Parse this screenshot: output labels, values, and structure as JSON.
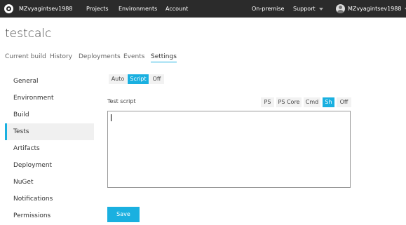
{
  "topbar": {
    "username": "MZvyagintsev1988",
    "nav": [
      "Projects",
      "Environments",
      "Account"
    ],
    "right": {
      "on_premise": "On-premise",
      "support": "Support",
      "user": "MZvyagintsev1988"
    }
  },
  "project": {
    "title": "testcalc"
  },
  "tabs": [
    "Current build",
    "History",
    "Deployments",
    "Events",
    "Settings"
  ],
  "active_tab": "Settings",
  "sidebar": {
    "items": [
      "General",
      "Environment",
      "Build",
      "Tests",
      "Artifacts",
      "Deployment",
      "NuGet",
      "Notifications",
      "Permissions"
    ],
    "active": "Tests"
  },
  "mode": {
    "options": [
      "Auto",
      "Script",
      "Off"
    ],
    "selected": "Script"
  },
  "test_script": {
    "label": "Test script",
    "langs": [
      "PS",
      "PS Core",
      "Cmd",
      "Sh",
      "Off"
    ],
    "selected": "Sh",
    "value": ""
  },
  "save_label": "Save",
  "colors": {
    "accent": "#1ab0e0",
    "topbar": "#2b2b2b"
  }
}
